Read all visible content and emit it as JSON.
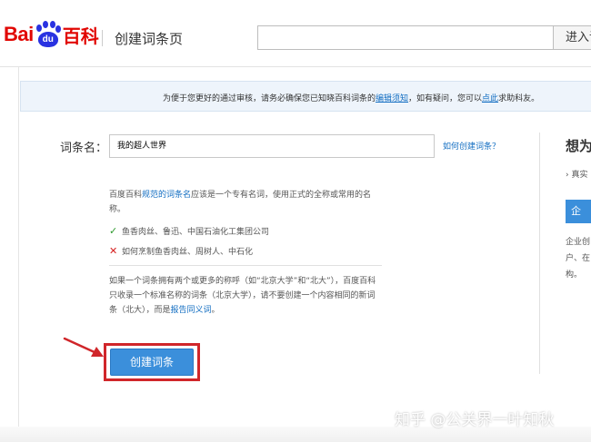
{
  "header": {
    "logo_bai": "Bai",
    "logo_du": "du",
    "logo_baike": "百科",
    "page_title": "创建词条页",
    "search_value": "",
    "search_button": "进入词条"
  },
  "notice": {
    "prefix": "为便于您更好的通过审核，请务必确保您已知晓百科词条的",
    "link_rules": "编辑须知",
    "middle": "，如有疑问，您可以",
    "link_click": "点此",
    "suffix": "求助科友。"
  },
  "form": {
    "label": "词条名：",
    "value": "我的超人世界",
    "how_link": "如何创建词条？",
    "hint1_prefix": "百度百科",
    "hint1_link": "规范的词条名",
    "hint1_suffix": "应该是一个专有名词，使用正式的全称或常用的名称。",
    "ok_example": "鱼香肉丝、鲁迅、中国石油化工集团公司",
    "bad_example": "如何烹制鱼香肉丝、周树人、中石化",
    "hint2_text": "如果一个词条拥有两个或更多的称呼（如“北京大学”和“北大”），百度百科只收录一个标准名称的词条（北京大学），请不要创建一个内容相同的新词条（北大），而是",
    "hint2_link": "报告同义词",
    "hint2_end": "。",
    "create_button": "创建词条"
  },
  "right_panel": {
    "title": "想为",
    "item": "› 真实",
    "button": "企",
    "desc": "企业创户、在构。"
  },
  "watermark": "知乎 @公关界一叶知秋",
  "colors": {
    "brand_red": "#e10602",
    "brand_blue": "#2932e1",
    "link": "#136ec2",
    "button_blue": "#3b8fdb",
    "highlight_red": "#d0262a"
  }
}
